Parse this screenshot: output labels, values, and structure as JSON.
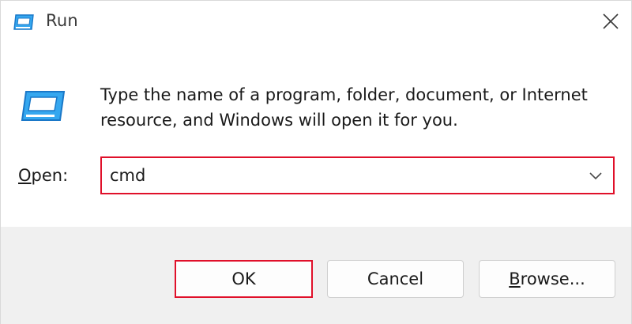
{
  "window": {
    "title": "Run",
    "title_icon": "run-app-icon",
    "close_icon": "close-icon"
  },
  "content": {
    "app_icon": "run-app-icon",
    "description": "Type the name of a program, folder, document, or Internet resource, and Windows will open it for you.",
    "open_label_mnemonic": "O",
    "open_label_rest": "pen:",
    "open_value": "cmd",
    "dropdown_icon": "chevron-down-icon"
  },
  "buttons": {
    "ok_label": "OK",
    "cancel_label": "Cancel",
    "browse_mnemonic": "B",
    "browse_rest": "rowse..."
  },
  "colors": {
    "highlight": "#e0102a",
    "icon_blue": "#1a8ce0",
    "footer_bg": "#f0f0f0"
  }
}
